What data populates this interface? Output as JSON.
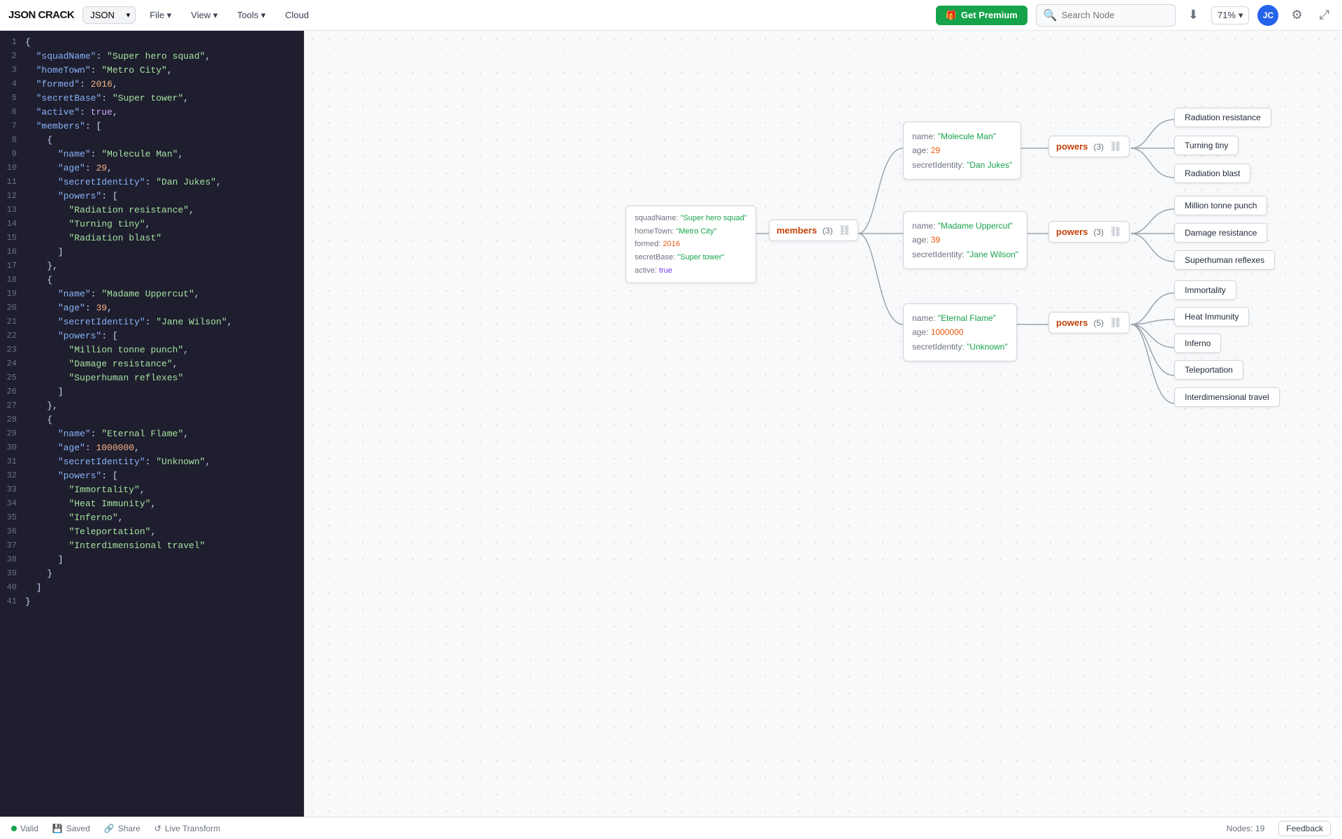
{
  "app": {
    "title": "JSON CRACK",
    "format": "JSON",
    "menus": [
      "File",
      "View",
      "Tools",
      "Cloud"
    ],
    "premium_label": "Get Premium",
    "search_placeholder": "Search Node",
    "zoom": "71%",
    "avatar": "JC"
  },
  "statusbar": {
    "valid": "Valid",
    "saved": "Saved",
    "share": "Share",
    "live_transform": "Live Transform",
    "nodes": "Nodes: 19",
    "feedback": "Feedback"
  },
  "json_data": {
    "squadName": "Super hero squad",
    "homeTown": "Metro City",
    "formed": 2016,
    "secretBase": "Super tower",
    "active": true,
    "members": [
      {
        "name": "Molecule Man",
        "age": 29,
        "secretIdentity": "Dan Jukes",
        "powers": [
          "Radiation resistance",
          "Turning tiny",
          "Radiation blast"
        ]
      },
      {
        "name": "Madame Uppercut",
        "age": 39,
        "secretIdentity": "Jane Wilson",
        "powers": [
          "Million tonne punch",
          "Damage resistance",
          "Superhuman reflexes"
        ]
      },
      {
        "name": "Eternal Flame",
        "age": 1000000,
        "secretIdentity": "Unknown",
        "powers": [
          "Immortality",
          "Heat Immunity",
          "Inferno",
          "Teleportation",
          "Interdimensional travel"
        ]
      }
    ]
  },
  "graph": {
    "root": {
      "squadName": "Super hero squad",
      "homeTown": "Metro City",
      "formed": 2016,
      "secretBase": "Super tower",
      "active": "true"
    },
    "members_count": "(3)",
    "member1": {
      "name": "Molecule Man",
      "age": 29,
      "secretIdentity": "Dan Jukes"
    },
    "member2": {
      "name": "Madame Uppercut",
      "age": 39,
      "secretIdentity": "Jane Wilson"
    },
    "member3": {
      "name": "Eternal Flame",
      "age": 1000000,
      "secretIdentity": "Unknown"
    },
    "powers1_count": "(3)",
    "powers2_count": "(3)",
    "powers3_count": "(5)",
    "member1_powers": [
      "Radiation resistance",
      "Turning tiny",
      "Radiation blast"
    ],
    "member2_powers": [
      "Million tonne punch",
      "Damage resistance",
      "Superhuman reflexes"
    ],
    "member3_powers": [
      "Immortality",
      "Heat Immunity",
      "Inferno",
      "Teleportation",
      "Interdimensional travel"
    ]
  }
}
